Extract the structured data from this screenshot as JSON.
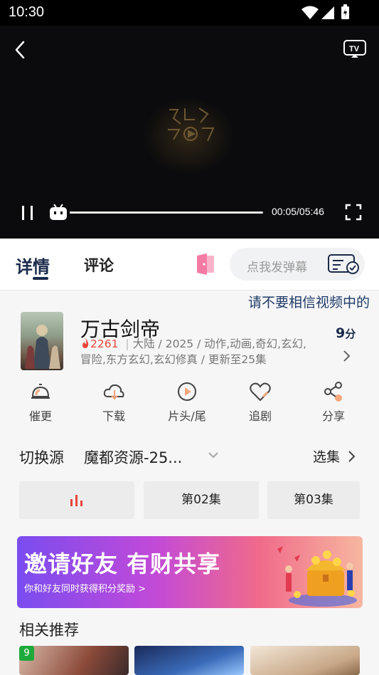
{
  "status_bar": {
    "time": "10:30"
  },
  "player": {
    "current_time": "00:05",
    "total_time": "05:46",
    "time_display": "00:05/05:46",
    "progress": 0.015
  },
  "tabs": {
    "detail": "详情",
    "comment": "评论"
  },
  "danmu": {
    "placeholder": "点我发弹幕"
  },
  "notice": "请不要相信视频中的",
  "show": {
    "title": "万古剑帝",
    "heat": "2261",
    "separator": "|",
    "info": "大陆 / 2025 / 动作,动画,奇幻,玄幻,冒险,东方玄幻,玄幻修真 / 更新至25集",
    "score": "9",
    "score_unit": "分"
  },
  "actions": [
    {
      "label": "催更",
      "icon": "bell-icon"
    },
    {
      "label": "下载",
      "icon": "download-cloud-icon"
    },
    {
      "label": "片头/尾",
      "icon": "play-circle-icon"
    },
    {
      "label": "追剧",
      "icon": "heart-icon"
    },
    {
      "label": "分享",
      "icon": "share-icon"
    }
  ],
  "source": {
    "label": "切换源",
    "value": "魔都资源-25..."
  },
  "episodes_label": "选集",
  "episodes": [
    "",
    "第02集",
    "第03集"
  ],
  "banner": {
    "title": "邀请好友 有财共享",
    "subtitle": "你和好友同时获得积分奖励 >"
  },
  "related": {
    "title": "相关推荐",
    "badge": "9"
  },
  "colors": {
    "accent": "#1b2a4a",
    "heat": "#e8463a",
    "playing": "#e8463a"
  }
}
